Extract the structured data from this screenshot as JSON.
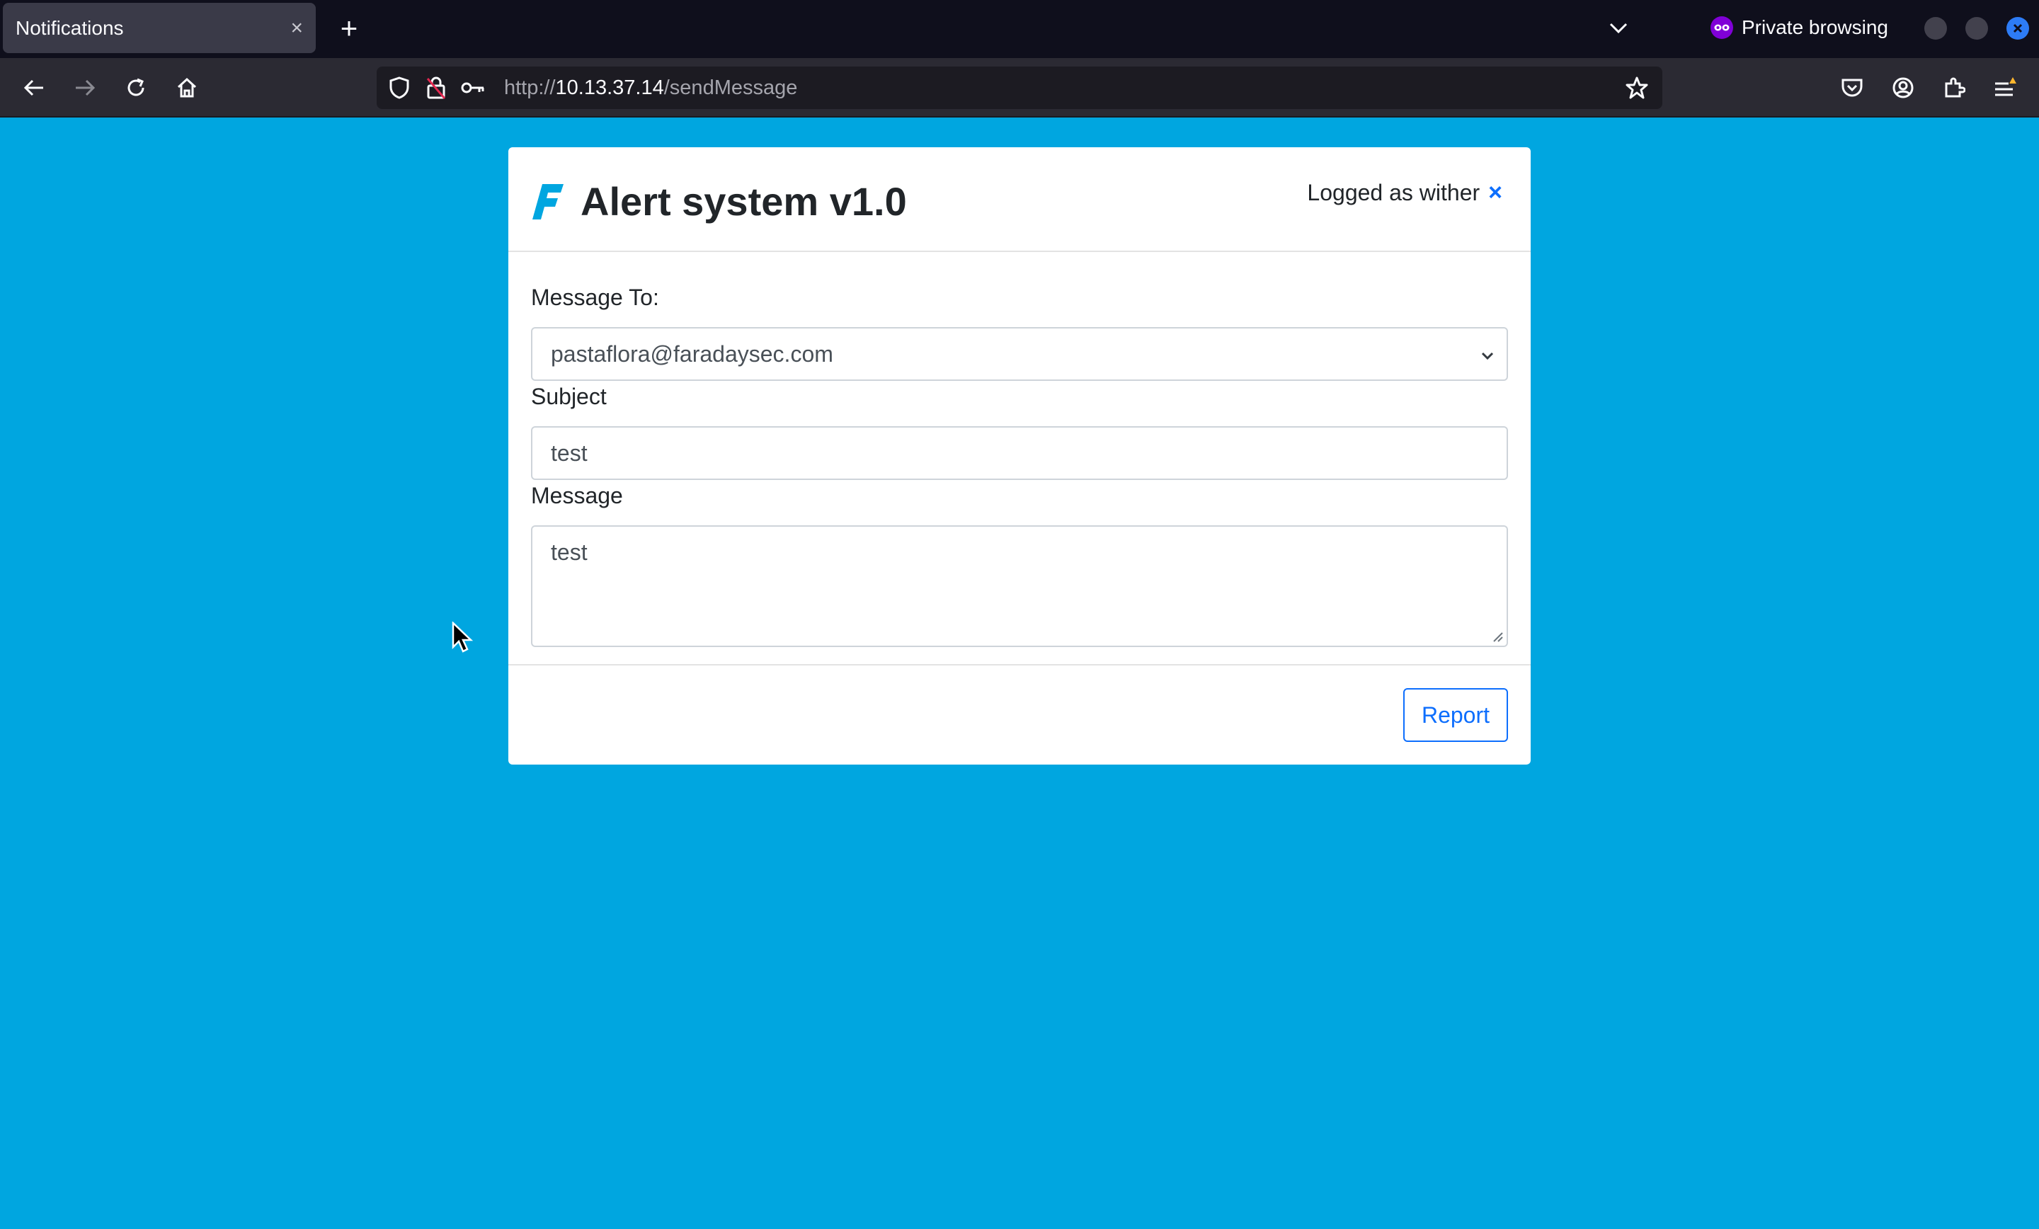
{
  "browser": {
    "tab_title": "Notifications",
    "tab_close": "×",
    "new_tab": "+",
    "private_label": "Private browsing",
    "url_prefix": "http://",
    "url_host": "10.13.37.14",
    "url_path": "/sendMessage"
  },
  "app": {
    "title": "Alert system v1.0",
    "logged_as": "Logged as wither",
    "logout_symbol": "×",
    "brand_color": "#00a6e0"
  },
  "form": {
    "to_label": "Message To:",
    "to_value": "pastaflora@faradaysec.com",
    "subject_label": "Subject",
    "subject_value": "test",
    "message_label": "Message",
    "message_value": "test",
    "report_label": "Report"
  }
}
